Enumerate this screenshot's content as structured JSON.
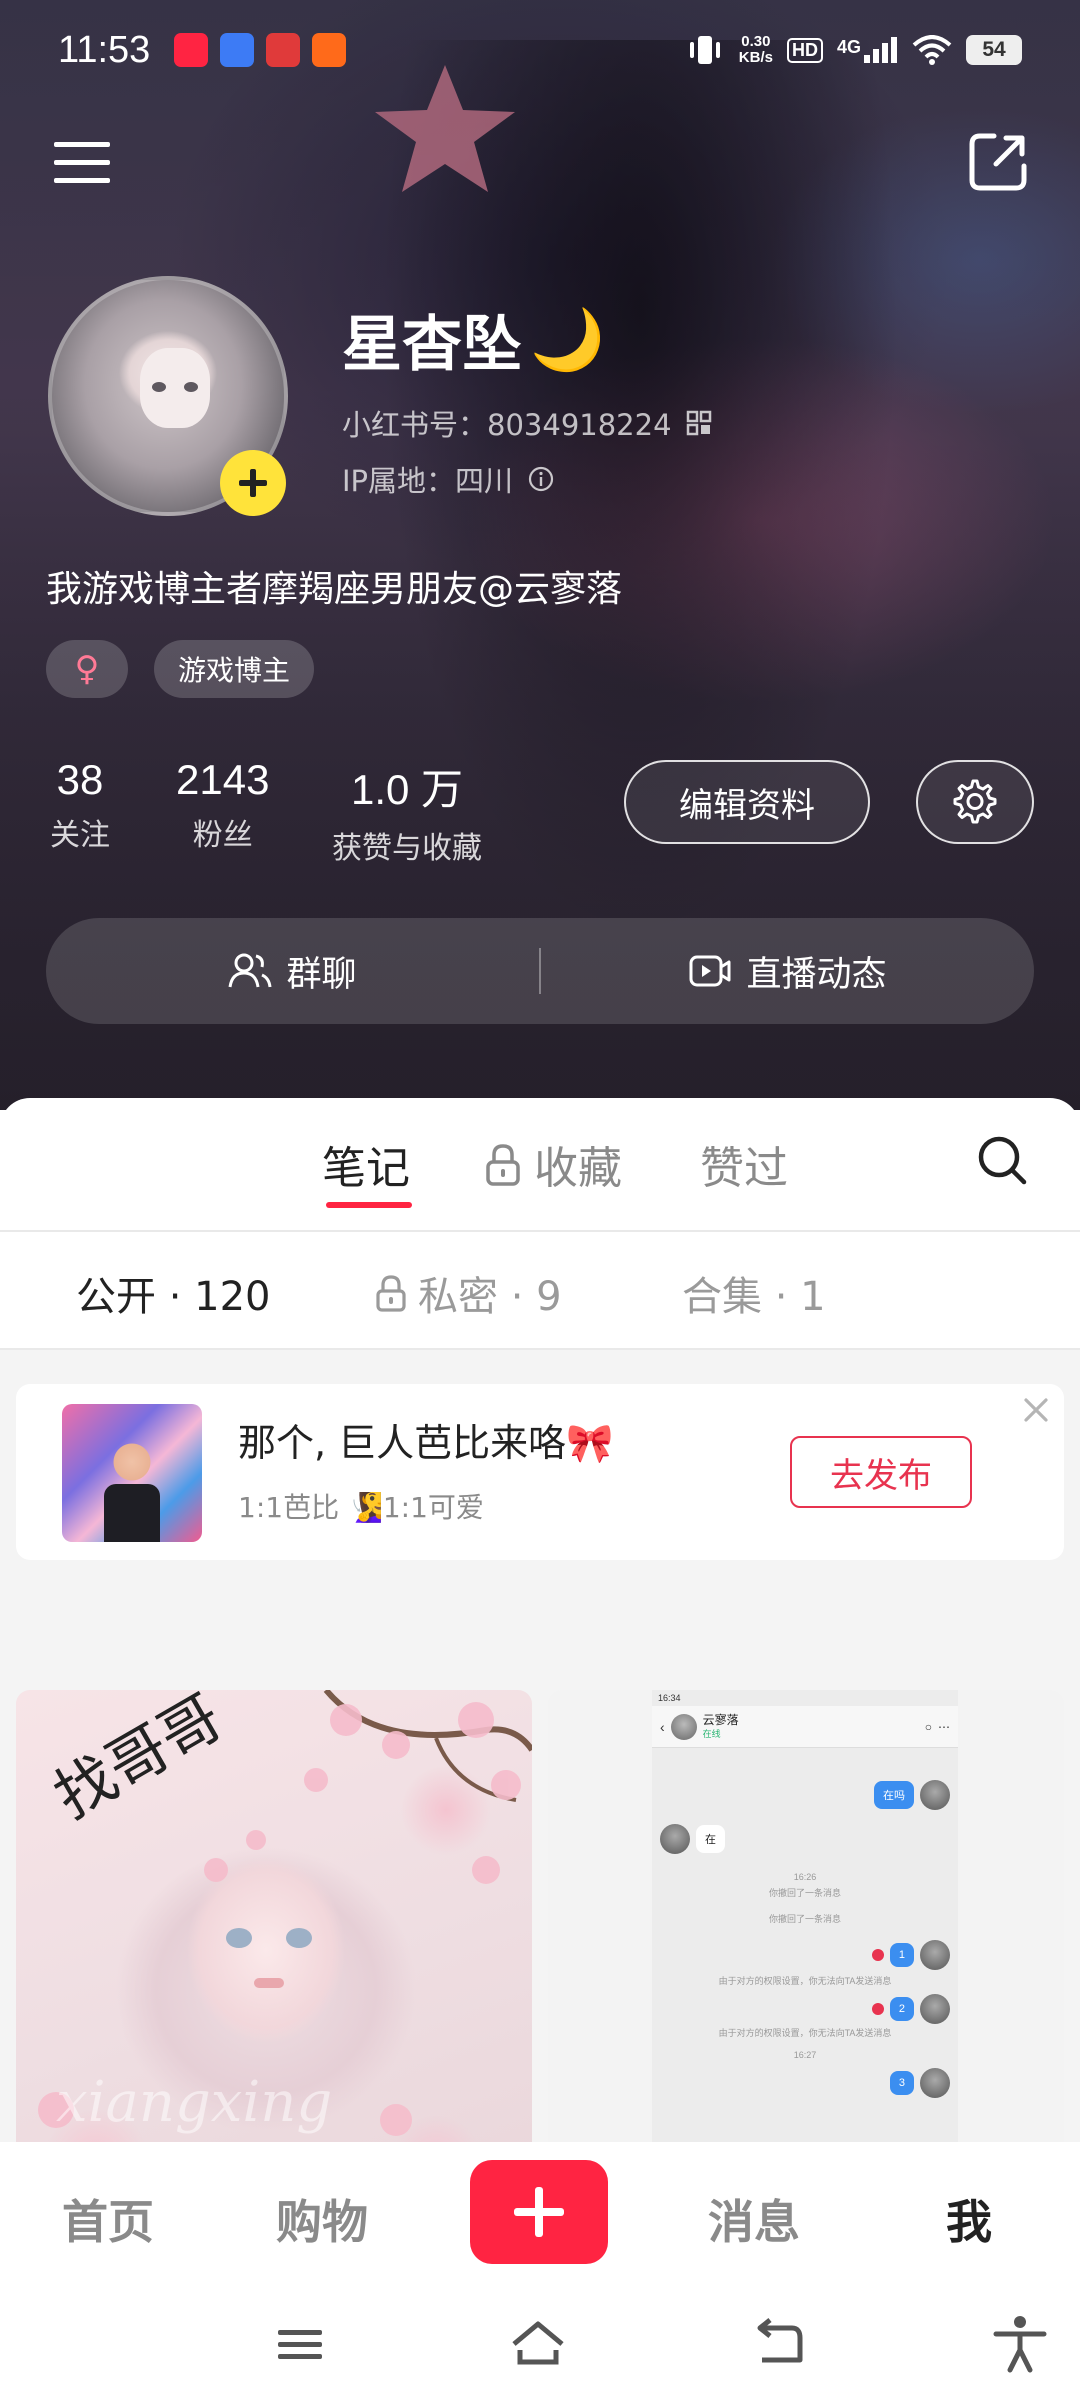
{
  "status_bar": {
    "time": "11:53",
    "net_speed_value": "0.30",
    "net_speed_unit": "KB/s",
    "hd": "HD",
    "network": "4G",
    "battery": "54"
  },
  "profile": {
    "nickname": "星杳坠",
    "nickname_emoji": "🌙",
    "id_label": "小红书号：",
    "id_value": "8034918224",
    "ip_label": "IP属地：",
    "ip_value": "四川",
    "bio": "我游戏博主者摩羯座男朋友@云寥落",
    "tags": {
      "gender": "♀",
      "category": "游戏博主"
    },
    "stats": [
      {
        "value": "38",
        "label": "关注"
      },
      {
        "value": "2143",
        "label": "粉丝"
      },
      {
        "value": "1.0 万",
        "label": "获赞与收藏"
      }
    ],
    "edit_button": "编辑资料",
    "quick_actions": {
      "group_chat": "群聊",
      "live": "直播动态"
    }
  },
  "tabs": {
    "notes": "笔记",
    "collect": "收藏",
    "liked": "赞过",
    "active": "笔记"
  },
  "subtabs": {
    "public": "公开 · 120",
    "private": "私密 · 9",
    "collection": "合集 · 1"
  },
  "promo": {
    "title": "那个, 巨人芭比来咯🎀",
    "subtitle": "1:1芭比 🧏‍♀️1:1可爱",
    "button": "去发布"
  },
  "notes": [
    {
      "overlay_text": "找哥哥",
      "watermark": "xiangxing"
    },
    {
      "chat": {
        "status_time": "16:34",
        "contact": "云寥落",
        "presence": "在线",
        "msg1": "在吗",
        "msg2": "在",
        "time1": "16:26",
        "recall1": "你撤回了一条消息",
        "recall2": "你撤回了一条消息",
        "msg3": "1",
        "blocked1": "由于对方的权限设置，你无法向TA发送消息",
        "msg4": "2",
        "blocked2": "由于对方的权限设置，你无法向TA发送消息",
        "time2": "16:27",
        "msg5": "3"
      }
    }
  ],
  "bottom_nav": {
    "home": "首页",
    "shop": "购物",
    "messages": "消息",
    "me": "我",
    "active": "我"
  },
  "colors": {
    "accent": "#ff2442",
    "avatar_badge": "#ffe33a"
  }
}
